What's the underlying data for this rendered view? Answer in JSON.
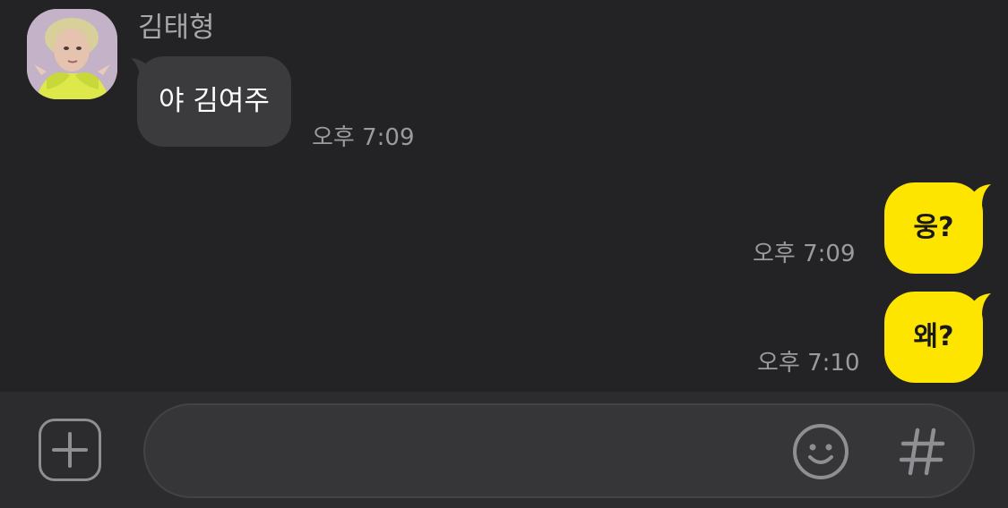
{
  "conversation": {
    "sender_name": "김태형",
    "messages": [
      {
        "direction": "incoming",
        "text": "야 김여주",
        "time": "오후 7:09"
      },
      {
        "direction": "outgoing",
        "text": "웅?",
        "time": "오후 7:09"
      },
      {
        "direction": "outgoing",
        "text": "왜?",
        "time": "오후 7:10"
      }
    ]
  },
  "input_bar": {
    "message_value": "",
    "placeholder": "",
    "icons": [
      "plus-icon",
      "emoji-icon",
      "hashtag-icon"
    ]
  },
  "colors": {
    "background": "#232325",
    "incoming_bubble": "#3b3b3d",
    "outgoing_bubble": "#fee500",
    "input_bar": "#2c2c2e",
    "time_text": "#9b9b9e"
  }
}
